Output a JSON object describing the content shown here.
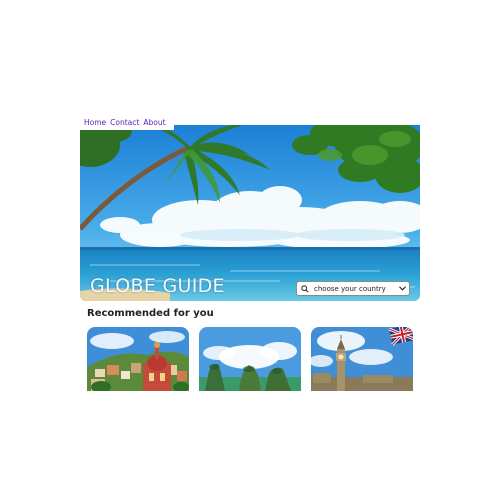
{
  "nav": {
    "items": [
      "Home",
      "Contact",
      "About"
    ]
  },
  "hero": {
    "title": "GLOBE GUIDE"
  },
  "country_select": {
    "selected": "choose your country",
    "icon": "search-icon"
  },
  "recommended": {
    "title": "Recommended for you",
    "cards": [
      {
        "subject": "colorful hillside town with domed church"
      },
      {
        "subject": "karst limestone islands in green bay"
      },
      {
        "subject": "london clock tower with british flag"
      }
    ]
  },
  "colors": {
    "nav_link": "#5a1fb0",
    "sky": "#3a9be0",
    "sea": "#1f86c4"
  }
}
